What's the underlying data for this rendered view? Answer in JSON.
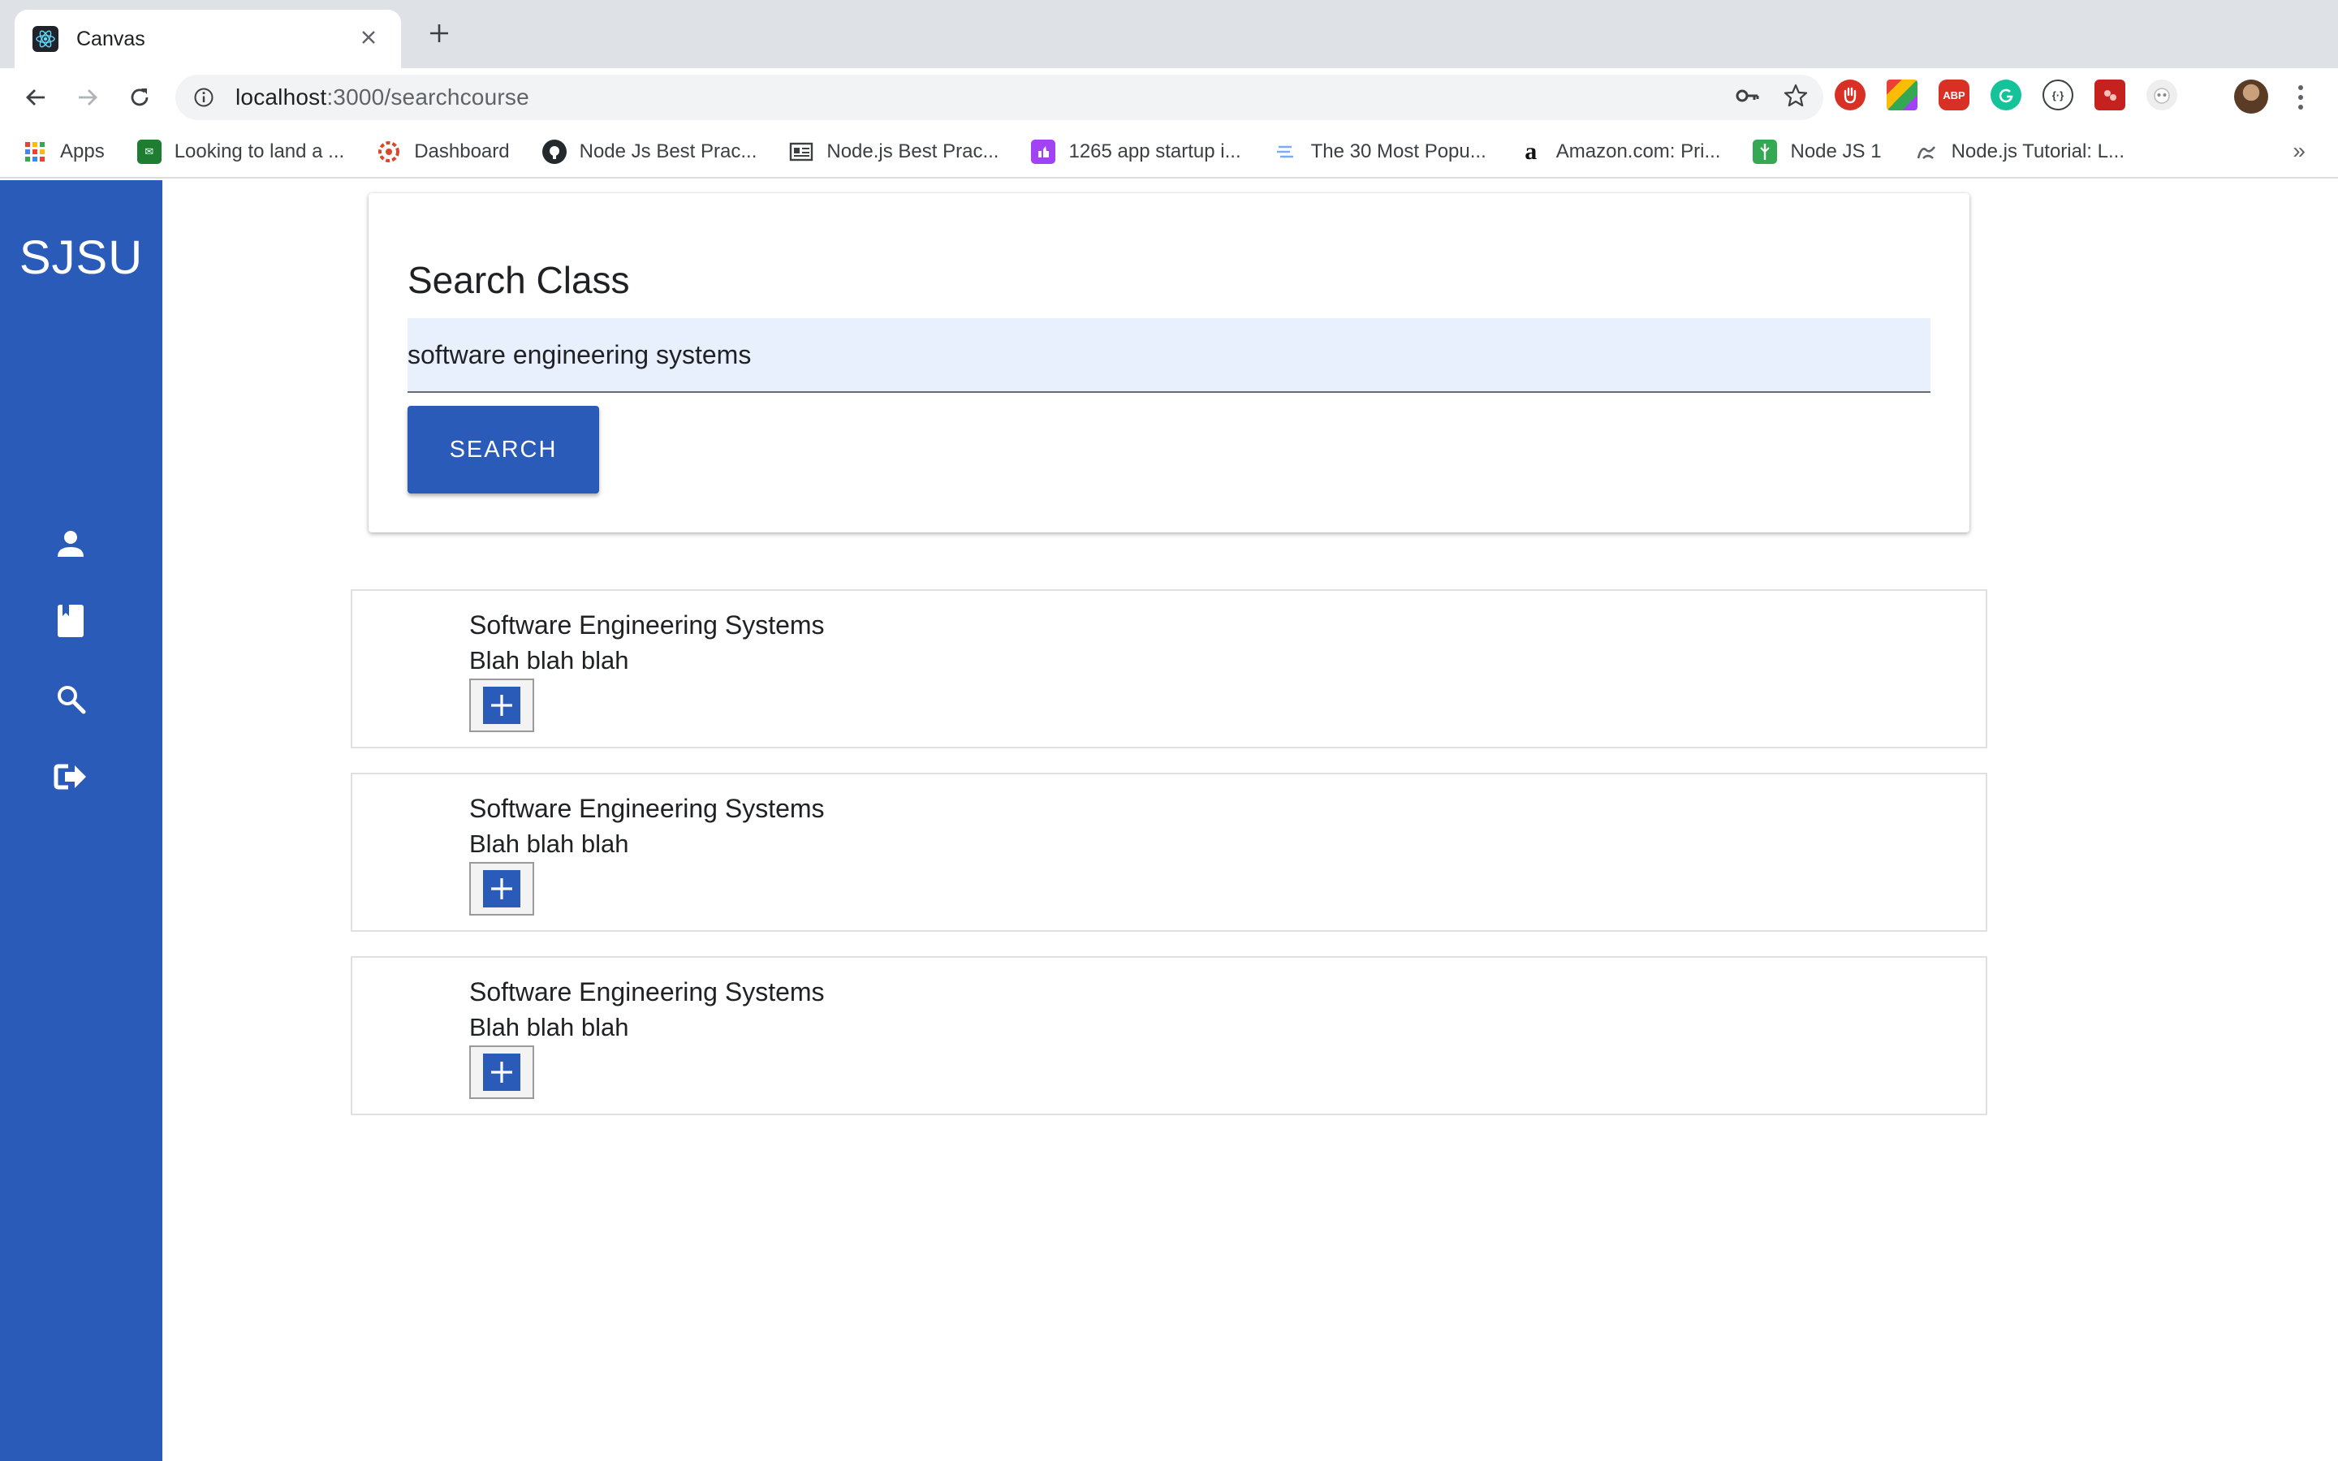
{
  "browser": {
    "tab_title": "Canvas",
    "tab_favicon": "react-icon",
    "new_tab": "+",
    "url_host": "localhost",
    "url_path": ":3000/searchcourse",
    "bookmarks": [
      {
        "label": "Apps",
        "icon": "apps-grid-icon",
        "color": "#4285f4"
      },
      {
        "label": "Looking to land a ...",
        "icon": "bookmark-favicon",
        "color": "#1e7d32"
      },
      {
        "label": "Dashboard",
        "icon": "dashboard-favicon",
        "color": "#d9482b"
      },
      {
        "label": "Node Js Best Prac...",
        "icon": "github-icon",
        "color": "#24292e"
      },
      {
        "label": "Node.js Best Prac...",
        "icon": "card-favicon",
        "color": "#3c4043"
      },
      {
        "label": "1265 app startup i...",
        "icon": "purple-favicon",
        "color": "#a142f4"
      },
      {
        "label": "The 30 Most Popu...",
        "icon": "lines-favicon",
        "color": "#7baaf7"
      },
      {
        "label": "Amazon.com: Pri...",
        "icon": "amazon-icon",
        "color": "#111111"
      },
      {
        "label": "Node JS 1",
        "icon": "green-doc-favicon",
        "color": "#34a853"
      },
      {
        "label": "Node.js Tutorial: L...",
        "icon": "link-favicon",
        "color": "#5f6368"
      }
    ],
    "bookmarks_overflow": "»"
  },
  "sidebar": {
    "brand": "SJSU",
    "items": [
      {
        "icon": "user-icon"
      },
      {
        "icon": "book-icon"
      },
      {
        "icon": "search-icon"
      },
      {
        "icon": "logout-icon"
      }
    ]
  },
  "search": {
    "title": "Search Class",
    "query": "software engineering systems",
    "button_label": "SEARCH"
  },
  "results": [
    {
      "title": "Software Engineering Systems",
      "description": "Blah blah blah"
    },
    {
      "title": "Software Engineering Systems",
      "description": "Blah blah blah"
    },
    {
      "title": "Software Engineering Systems",
      "description": "Blah blah blah"
    }
  ],
  "colors": {
    "accent": "#2b5bb8",
    "input_background": "#e8f0fe"
  }
}
